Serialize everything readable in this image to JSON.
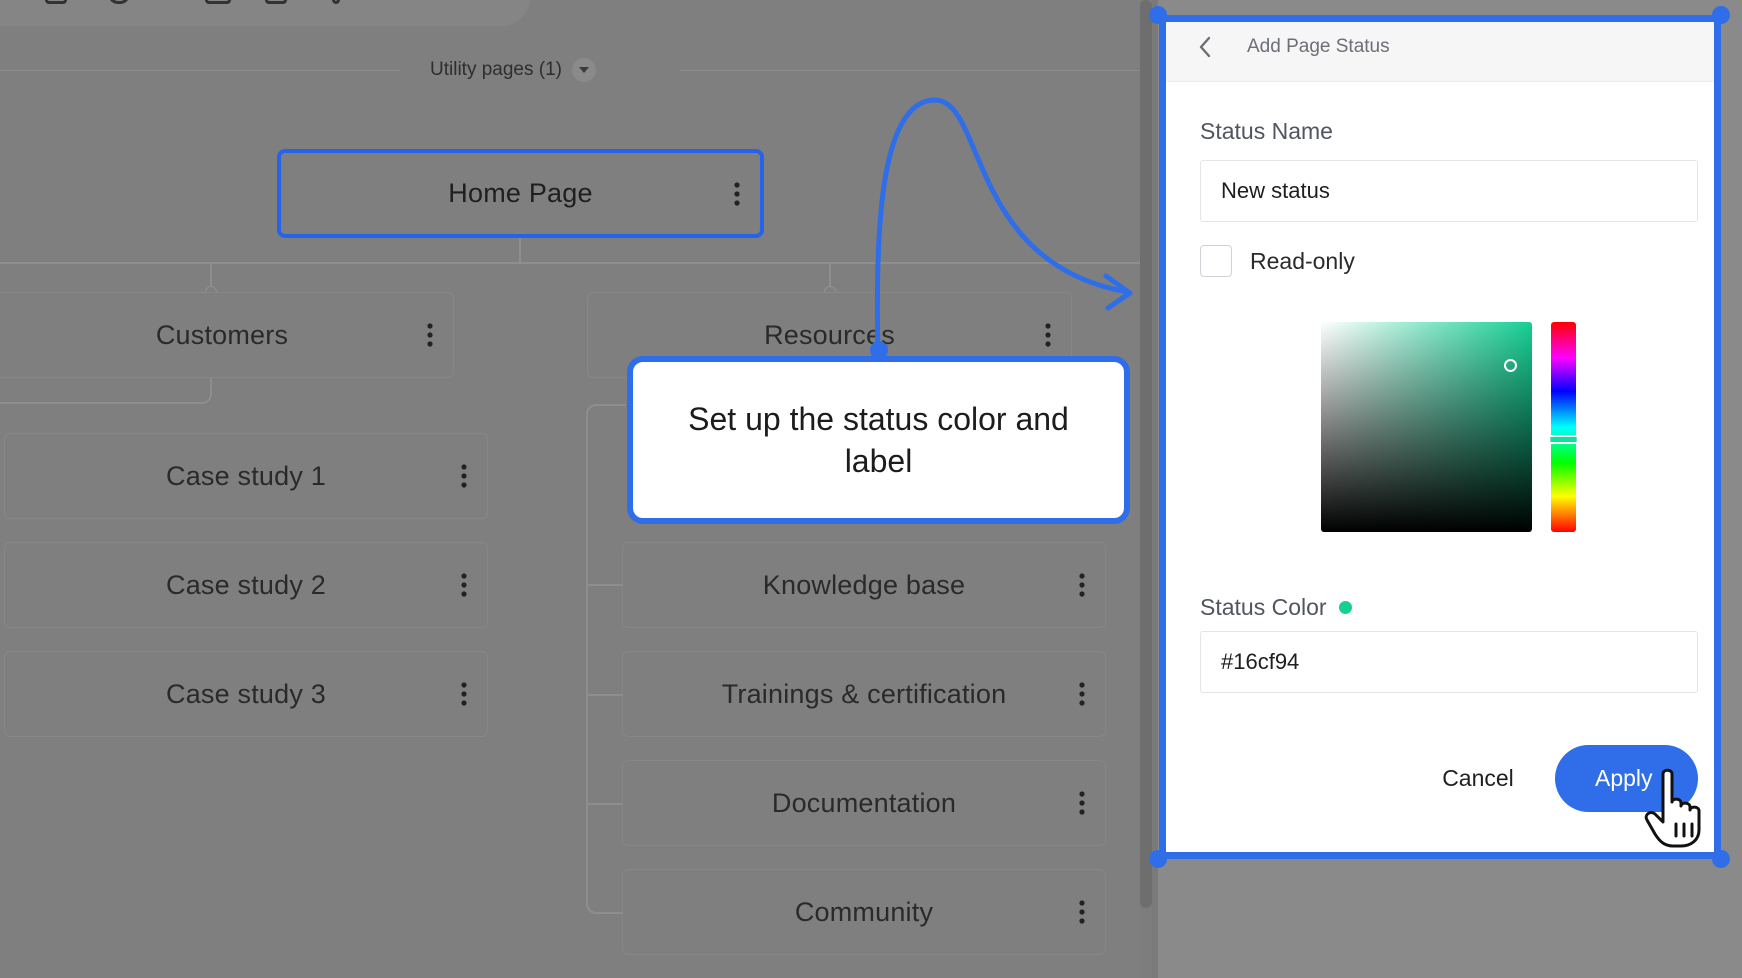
{
  "sitemap": {
    "utility_label": "Utility pages (1)",
    "home": "Home Page",
    "sections": [
      {
        "label": "Customers",
        "children": [
          "Case study 1",
          "Case study 2",
          "Case study 3"
        ]
      },
      {
        "label": "Resources",
        "children": [
          "Knowledge base",
          "Trainings & certification",
          "Documentation",
          "Community"
        ]
      }
    ]
  },
  "callout": {
    "text": "Set up the status color and label"
  },
  "panel": {
    "title": "Add Page Status",
    "status_name_label": "Status Name",
    "status_name_value": "New status",
    "readonly_label": "Read-only",
    "readonly_checked": false,
    "status_color_label": "Status Color",
    "status_color_value": "#16cf94",
    "cancel_label": "Cancel",
    "apply_label": "Apply"
  },
  "colors": {
    "accent": "#2f6ee8",
    "status": "#16cf94",
    "apply": "#2f6ee8"
  },
  "icons": {
    "back": "chevron-left-icon",
    "kebab": "kebab-menu-icon",
    "dropdown": "chevron-down-icon",
    "cursor": "hand-pointer-icon"
  }
}
